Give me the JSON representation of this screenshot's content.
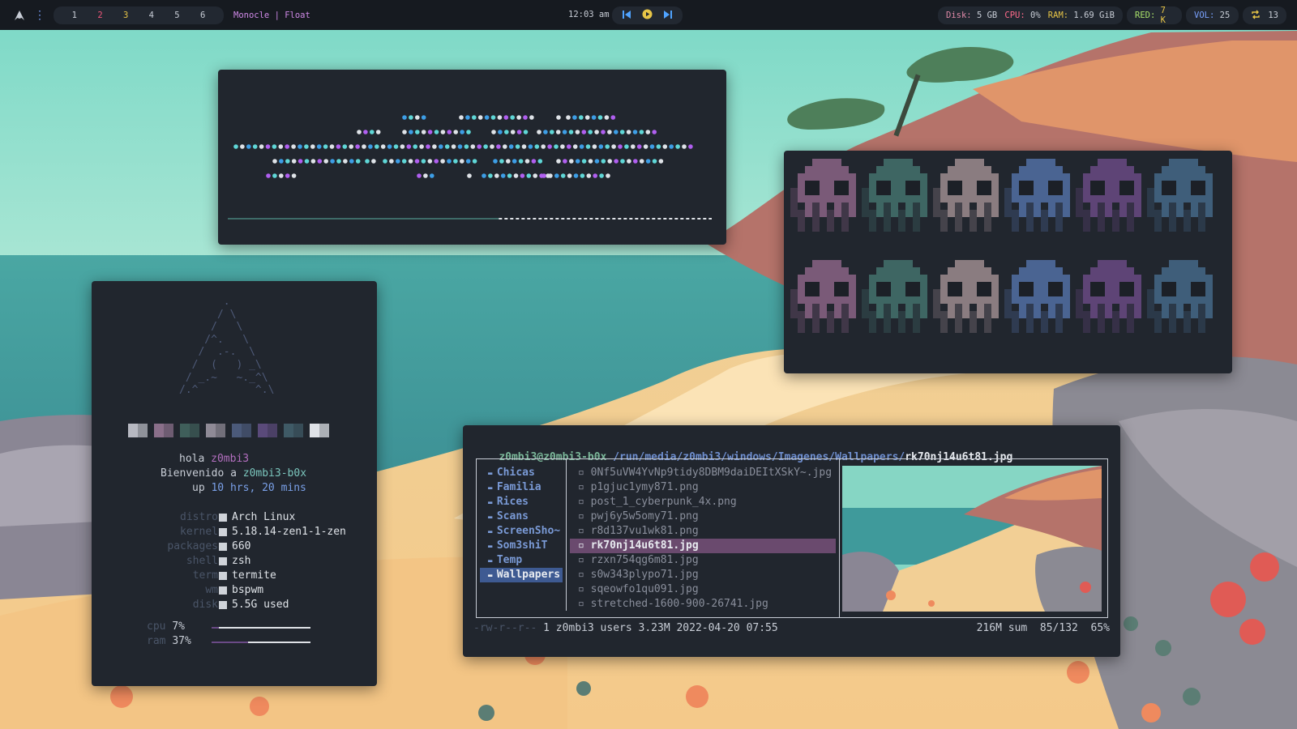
{
  "topbar": {
    "workspaces": [
      "1",
      "2",
      "3",
      "4",
      "5",
      "6"
    ],
    "workspace_colors": [
      "#c8cdd6",
      "#f0567a",
      "#e7c547",
      "#c8cdd6",
      "#c8cdd6",
      "#c8cdd6"
    ],
    "layout_label": "Monocle | Float",
    "clock": "12:03 am",
    "media_icons": [
      "skip-previous-icon",
      "play-icon",
      "skip-next-icon"
    ],
    "stats": {
      "disk_label": "Disk:",
      "disk_value": "5 GB",
      "cpu_label": "CPU:",
      "cpu_value": "0%",
      "ram_label": "RAM:",
      "ram_value": "1.69 GiB"
    },
    "red_label": "RED:",
    "red_value": "7 K",
    "vol_label": "VOL:",
    "vol_value": "25",
    "updates_value": "13",
    "colors": {
      "disk": "#e08aa8",
      "cpu": "#ff6b8b",
      "ram": "#e7c547",
      "red": "#a8e06a",
      "vol": "#7aa2ff",
      "updates": "#e7c547"
    }
  },
  "fetch": {
    "ascii_logo": "       .\n      / \\\n     /   \\\n    /^.   \\\n   /  .-.  \\\n  /  (   ) _\\\n / _.~   ~._^\\\n/.^         ^.\\",
    "swatches": [
      "#b7b9c2",
      "#8a6f8a",
      "#3f5e5a",
      "#8f8a96",
      "#4b5a7a",
      "#5a4a7a",
      "#3f5a66",
      "#dfe2e7"
    ],
    "greeting": "hola",
    "user": "z0mbi3",
    "welcome": "Bienvenido a",
    "host": "z0mbi3-b0x",
    "up_label": "up",
    "uptime": "10 hrs, 20 mins",
    "info": [
      {
        "label": "distro",
        "value": "Arch Linux"
      },
      {
        "label": "kernel",
        "value": "5.18.14-zen1-1-zen"
      },
      {
        "label": "packages",
        "value": "660"
      },
      {
        "label": "shell",
        "value": "zsh"
      },
      {
        "label": "term",
        "value": "termite"
      },
      {
        "label": "wm",
        "value": "bspwm"
      },
      {
        "label": "disk",
        "value": "5.5G used"
      }
    ],
    "cpu_label": "cpu",
    "cpu_value": "7%",
    "cpu_fraction": 0.07,
    "ram_label": "ram",
    "ram_value": "37%",
    "ram_fraction": 0.37
  },
  "skulls": {
    "colors": [
      "#7a5a78",
      "#3e6663",
      "#8a7c80",
      "#4a6492",
      "#5e4476",
      "#3f5e7a"
    ]
  },
  "visualizer": {
    "progress_fraction": 0.56,
    "colors": {
      "text": "#dfe3e8",
      "cyan": "#5fd7d7",
      "purple": "#b05ff0",
      "blue": "#3d9ee6"
    }
  },
  "ranger": {
    "userhost": "z0mbi3@z0mbi3-b0x",
    "path": "/run/media/z0mbi3/windows/Imagenes/Wallpapers/",
    "selected_file": "rk70nj14u6t81.jpg",
    "dirs": [
      "Chicas",
      "Familia",
      "Rices",
      "Scans",
      "ScreenSho~",
      "Som3shiT",
      "Temp",
      "Wallpapers"
    ],
    "selected_dir_index": 7,
    "files": [
      "0Nf5uVW4YvNp9tidy8DBM9daiDEItXSkY~.jpg",
      "p1gjuc1ymy871.png",
      "post_1_cyberpunk_4x.png",
      "pwj6y5w5omy71.png",
      "r8d137vu1wk81.png",
      "rk70nj14u6t81.jpg",
      "rzxn754qg6m81.jpg",
      "s0w343plypo71.jpg",
      "sqeowfo1qu091.jpg",
      "stretched-1600-900-26741.jpg"
    ],
    "selected_file_index": 5,
    "status_perms": "-rw-r--r--",
    "status_info": "1 z0mbi3 users 3.23M 2022-04-20 07:55",
    "status_sum": "216M sum",
    "status_pos": "85/132",
    "status_pct": "65%"
  }
}
